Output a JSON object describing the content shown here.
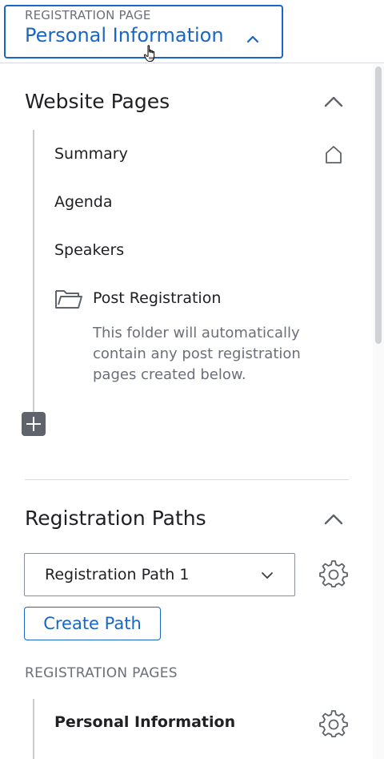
{
  "header": {
    "caption": "REGISTRATION PAGE",
    "value": "Personal Information",
    "icon": "chevron-up-icon"
  },
  "website_pages": {
    "title": "Website Pages",
    "items": [
      {
        "label": "Summary",
        "icon": "home-icon"
      },
      {
        "label": "Agenda"
      },
      {
        "label": "Speakers"
      }
    ],
    "folder": {
      "label": "Post Registration",
      "icon": "folder-icon",
      "description": "This folder will automatically contain any post registration pages created below."
    },
    "add_icon": "plus-icon"
  },
  "registration_paths": {
    "title": "Registration Paths",
    "selected_path": "Registration Path 1",
    "create_label": "Create Path",
    "pages_heading": "REGISTRATION PAGES",
    "pages": [
      {
        "label": "Personal Information",
        "icon": "gear-icon"
      }
    ]
  },
  "colors": {
    "accent": "#1a66c6",
    "text": "#1f1f24",
    "muted": "#6b6f78",
    "icon_fill": "#5f636b"
  }
}
